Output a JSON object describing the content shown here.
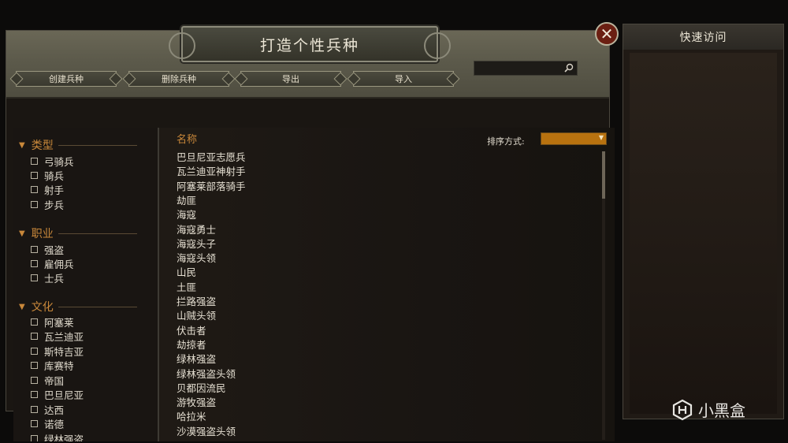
{
  "window": {
    "title": "打造个性兵种",
    "close_glyph": "✕"
  },
  "toolbar": {
    "create_label": "创建兵种",
    "delete_label": "删除兵种",
    "export_label": "导出",
    "import_label": "导入"
  },
  "search": {
    "value": "",
    "placeholder": ""
  },
  "filters": {
    "type": {
      "heading": "类型",
      "items": [
        "弓骑兵",
        "骑兵",
        "射手",
        "步兵"
      ]
    },
    "occupation": {
      "heading": "职业",
      "items": [
        "强盗",
        "雇佣兵",
        "士兵"
      ]
    },
    "culture": {
      "heading": "文化",
      "items": [
        "阿塞莱",
        "瓦兰迪亚",
        "斯特吉亚",
        "库赛特",
        "帝国",
        "巴旦尼亚",
        "达西",
        "诺德",
        "绿林强盗"
      ]
    }
  },
  "list": {
    "column_header": "名称",
    "sort_label": "排序方式:",
    "sort_value": "",
    "units": [
      "巴旦尼亚志愿兵",
      "瓦兰迪亚神射手",
      "阿塞莱部落骑手",
      "劫匪",
      "海寇",
      "海寇勇士",
      "海寇头子",
      "海寇头领",
      "山民",
      "土匪",
      "拦路强盗",
      "山贼头领",
      "伏击者",
      "劫掠者",
      "绿林强盗",
      "绿林强盗头领",
      "贝都因流民",
      "游牧强盗",
      "哈拉米",
      "沙漠强盗头领"
    ]
  },
  "quick_access": {
    "title": "快速访问"
  },
  "watermark": {
    "text": "小黑盒"
  },
  "colors": {
    "accent": "#c9883a",
    "sort_select": "#b8720f",
    "close_button": "#6b1f12"
  }
}
